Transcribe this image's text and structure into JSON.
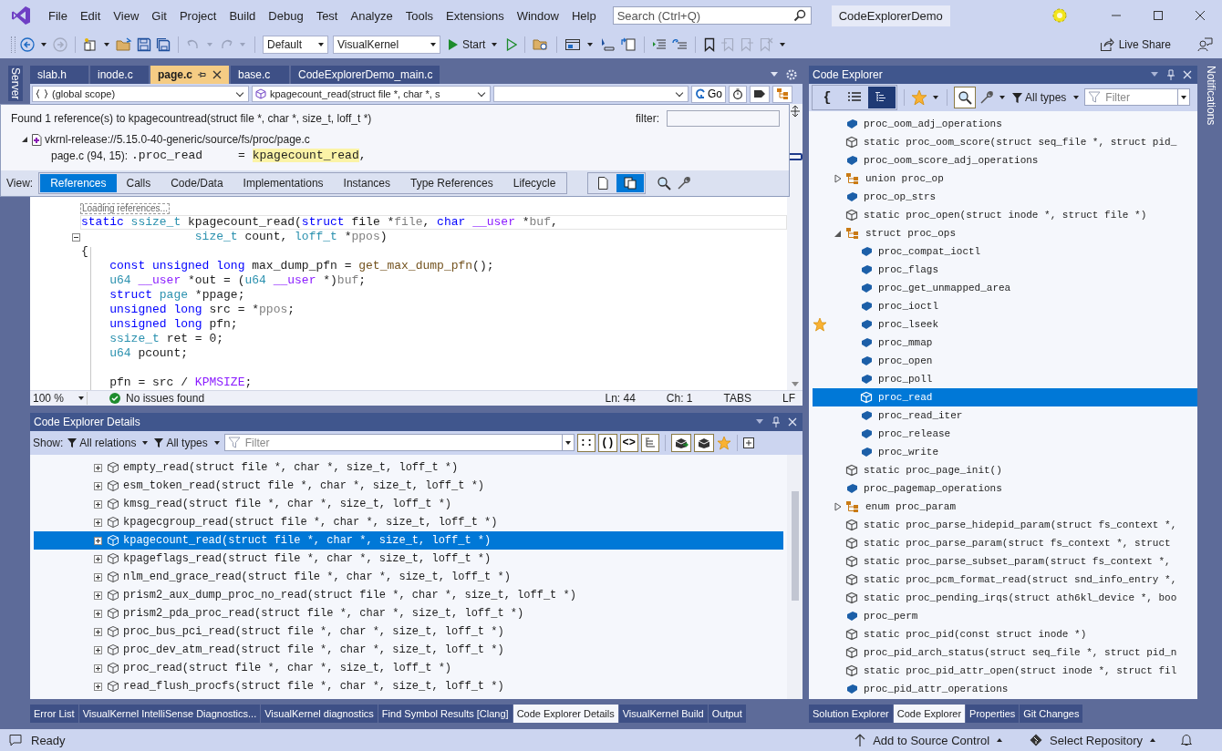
{
  "menu": [
    "File",
    "Edit",
    "View",
    "Git",
    "Project",
    "Build",
    "Debug",
    "Test",
    "Analyze",
    "Tools",
    "Extensions",
    "Window",
    "Help"
  ],
  "search": {
    "placeholder": "Search (Ctrl+Q)"
  },
  "solution_name": "CodeExplorerDemo",
  "toolbar": {
    "configuration": "Default",
    "platform": "VisualKernel",
    "start": "Start",
    "live_share": "Live Share"
  },
  "left_strip": "Server",
  "right_strip": "Notifications",
  "editor_tabs": [
    {
      "label": "slab.h",
      "selected": false
    },
    {
      "label": "inode.c",
      "selected": false
    },
    {
      "label": "page.c",
      "selected": true
    },
    {
      "label": "base.c",
      "selected": false
    },
    {
      "label": "CodeExplorerDemo_main.c",
      "selected": false
    }
  ],
  "nav_bar": {
    "scope": "(global scope)",
    "member": "kpagecount_read(struct file *, char *, s",
    "go": "Go"
  },
  "references_popup": {
    "summary": "Found 1 reference(s) to kpagecountread(struct file *, char *, size_t, loff_t *)",
    "filter_label": "filter:",
    "file": "vkrnl-release://5.15.0-40-generic/source/fs/proc/page.c",
    "expanded": true,
    "location": "page.c (94, 15):",
    "code_before": ".proc_read     = ",
    "match": "kpagecount_read",
    "code_after": ",",
    "view_label": "View:",
    "views": [
      {
        "label": "References",
        "selected": true
      },
      {
        "label": "Calls",
        "selected": false
      },
      {
        "label": "Code/Data",
        "selected": false
      },
      {
        "label": "Implementations",
        "selected": false
      },
      {
        "label": "Instances",
        "selected": false
      },
      {
        "label": "Type References",
        "selected": false
      },
      {
        "label": "Lifecycle",
        "selected": false
      }
    ]
  },
  "loading_hint": "Loading references...",
  "code_lines": [
    {
      "current": true,
      "tokens": [
        {
          "text": "static",
          "kind": "keyword"
        },
        {
          "text": " ssize_t",
          "kind": "type"
        },
        {
          "text": " kpagecount_read(",
          "kind": "plain"
        },
        {
          "text": "struct",
          "kind": "keyword"
        },
        {
          "text": " file *",
          "kind": "plain"
        },
        {
          "text": "file",
          "kind": "parameter"
        },
        {
          "text": ", ",
          "kind": "plain"
        },
        {
          "text": "char",
          "kind": "keyword"
        },
        {
          "text": " __user",
          "kind": "macro"
        },
        {
          "text": " *",
          "kind": "plain"
        },
        {
          "text": "buf",
          "kind": "parameter"
        },
        {
          "text": ",",
          "kind": "plain"
        }
      ]
    },
    {
      "current": false,
      "fold": true,
      "tokens": [
        {
          "text": "                size_t",
          "kind": "type"
        },
        {
          "text": " count, ",
          "kind": "plain"
        },
        {
          "text": "loff_t",
          "kind": "type"
        },
        {
          "text": " *",
          "kind": "plain"
        },
        {
          "text": "ppos",
          "kind": "parameter"
        },
        {
          "text": ")",
          "kind": "plain"
        }
      ]
    },
    {
      "current": false,
      "tokens": [
        {
          "text": "{",
          "kind": "plain"
        }
      ]
    },
    {
      "current": false,
      "tokens": [
        {
          "text": "    const unsigned long",
          "kind": "keyword"
        },
        {
          "text": " max_dump_pfn = ",
          "kind": "plain"
        },
        {
          "text": "get_max_dump_pfn",
          "kind": "function"
        },
        {
          "text": "();",
          "kind": "plain"
        }
      ]
    },
    {
      "current": false,
      "tokens": [
        {
          "text": "    u64",
          "kind": "type"
        },
        {
          "text": " __user",
          "kind": "macro"
        },
        {
          "text": " *out = (",
          "kind": "plain"
        },
        {
          "text": "u64",
          "kind": "type"
        },
        {
          "text": " __user",
          "kind": "macro"
        },
        {
          "text": " *)",
          "kind": "plain"
        },
        {
          "text": "buf",
          "kind": "parameter"
        },
        {
          "text": ";",
          "kind": "plain"
        }
      ]
    },
    {
      "current": false,
      "tokens": [
        {
          "text": "    struct",
          "kind": "keyword"
        },
        {
          "text": " page",
          "kind": "type"
        },
        {
          "text": " *ppage;",
          "kind": "plain"
        }
      ]
    },
    {
      "current": false,
      "tokens": [
        {
          "text": "    unsigned long",
          "kind": "keyword"
        },
        {
          "text": " src = *",
          "kind": "plain"
        },
        {
          "text": "ppos",
          "kind": "parameter"
        },
        {
          "text": ";",
          "kind": "plain"
        }
      ]
    },
    {
      "current": false,
      "tokens": [
        {
          "text": "    unsigned long",
          "kind": "keyword"
        },
        {
          "text": " pfn;",
          "kind": "plain"
        }
      ]
    },
    {
      "current": false,
      "tokens": [
        {
          "text": "    ssize_t",
          "kind": "type"
        },
        {
          "text": " ret = 0;",
          "kind": "plain"
        }
      ]
    },
    {
      "current": false,
      "tokens": [
        {
          "text": "    u64",
          "kind": "type"
        },
        {
          "text": " pcount;",
          "kind": "plain"
        }
      ]
    },
    {
      "current": false,
      "blank_before": true,
      "tokens": [
        {
          "text": "    pfn = src / ",
          "kind": "plain"
        },
        {
          "text": "KPMSIZE",
          "kind": "macro"
        },
        {
          "text": ";",
          "kind": "plain"
        }
      ]
    }
  ],
  "editor_status": {
    "zoom": "100 %",
    "issues": "No issues found",
    "line": "Ln: 44",
    "column": "Ch: 1",
    "indent": "TABS",
    "line_ending": "LF"
  },
  "details": {
    "title": "Code Explorer Details",
    "show_label": "Show:",
    "relations": "All relations",
    "types": "All types",
    "filter_placeholder": "Filter",
    "glyph_buttons": [
      "::",
      "()",
      "<>"
    ],
    "rows": [
      {
        "label": "empty_read(struct file *, char *, size_t, loff_t *)",
        "selected": false
      },
      {
        "label": "esm_token_read(struct file *, char *, size_t, loff_t *)",
        "selected": false
      },
      {
        "label": "kmsg_read(struct file *, char *, size_t, loff_t *)",
        "selected": false
      },
      {
        "label": "kpagecgroup_read(struct file *, char *, size_t, loff_t *)",
        "selected": false
      },
      {
        "label": "kpagecount_read(struct file *, char *, size_t, loff_t *)",
        "selected": true
      },
      {
        "label": "kpageflags_read(struct file *, char *, size_t, loff_t *)",
        "selected": false
      },
      {
        "label": "nlm_end_grace_read(struct file *, char *, size_t, loff_t *)",
        "selected": false
      },
      {
        "label": "prism2_aux_dump_proc_no_read(struct file *, char *, size_t, loff_t *)",
        "selected": false
      },
      {
        "label": "prism2_pda_proc_read(struct file *, char *, size_t, loff_t *)",
        "selected": false
      },
      {
        "label": "proc_bus_pci_read(struct file *, char *, size_t, loff_t *)",
        "selected": false
      },
      {
        "label": "proc_dev_atm_read(struct file *, char *, size_t, loff_t *)",
        "selected": false
      },
      {
        "label": "proc_read(struct file *, char *, size_t, loff_t *)",
        "selected": false
      },
      {
        "label": "read_flush_procfs(struct file *, char *, size_t, loff_t *)",
        "selected": false
      }
    ]
  },
  "code_explorer": {
    "title": "Code Explorer",
    "brace_button": "{",
    "types": "All types",
    "filter_placeholder": "Filter",
    "items": [
      {
        "kind": "field",
        "label": "proc_oom_adj_operations",
        "selected": false,
        "starred": false
      },
      {
        "kind": "method",
        "label": "static proc_oom_score(struct seq_file *, struct pid_",
        "selected": false,
        "starred": false
      },
      {
        "kind": "field",
        "label": "proc_oom_score_adj_operations",
        "selected": false,
        "starred": false
      },
      {
        "kind": "struct",
        "label": "union proc_op",
        "selected": false,
        "starred": false,
        "expanded": false
      },
      {
        "kind": "field",
        "label": "proc_op_strs",
        "selected": false,
        "starred": false
      },
      {
        "kind": "method",
        "label": "static proc_open(struct inode *, struct file *)",
        "selected": false,
        "starred": false
      },
      {
        "kind": "struct",
        "label": "struct proc_ops",
        "selected": false,
        "starred": false,
        "expanded": true,
        "children": [
          {
            "kind": "field",
            "label": "proc_compat_ioctl",
            "selected": false,
            "starred": false
          },
          {
            "kind": "field",
            "label": "proc_flags",
            "selected": false,
            "starred": false
          },
          {
            "kind": "field",
            "label": "proc_get_unmapped_area",
            "selected": false,
            "starred": false
          },
          {
            "kind": "field",
            "label": "proc_ioctl",
            "selected": false,
            "starred": false
          },
          {
            "kind": "field",
            "label": "proc_lseek",
            "selected": false,
            "starred": true
          },
          {
            "kind": "field",
            "label": "proc_mmap",
            "selected": false,
            "starred": false
          },
          {
            "kind": "field",
            "label": "proc_open",
            "selected": false,
            "starred": false
          },
          {
            "kind": "field",
            "label": "proc_poll",
            "selected": false,
            "starred": false
          },
          {
            "kind": "method",
            "label": "proc_read",
            "selected": true,
            "starred": false
          },
          {
            "kind": "field",
            "label": "proc_read_iter",
            "selected": false,
            "starred": false
          },
          {
            "kind": "field",
            "label": "proc_release",
            "selected": false,
            "starred": false
          },
          {
            "kind": "field",
            "label": "proc_write",
            "selected": false,
            "starred": false
          }
        ]
      },
      {
        "kind": "method",
        "label": "static proc_page_init()",
        "selected": false,
        "starred": false
      },
      {
        "kind": "field",
        "label": "proc_pagemap_operations",
        "selected": false,
        "starred": false
      },
      {
        "kind": "struct",
        "label": "enum proc_param",
        "selected": false,
        "starred": false,
        "expanded": false
      },
      {
        "kind": "method",
        "label": "static proc_parse_hidepid_param(struct fs_context *,",
        "selected": false,
        "starred": false
      },
      {
        "kind": "method",
        "label": "static proc_parse_param(struct fs_context *, struct",
        "selected": false,
        "starred": false
      },
      {
        "kind": "method",
        "label": "static proc_parse_subset_param(struct fs_context *,",
        "selected": false,
        "starred": false
      },
      {
        "kind": "method",
        "label": "static proc_pcm_format_read(struct snd_info_entry *,",
        "selected": false,
        "starred": false
      },
      {
        "kind": "method",
        "label": "static proc_pending_irqs(struct ath6kl_device *, boo",
        "selected": false,
        "starred": false
      },
      {
        "kind": "field",
        "label": "proc_perm",
        "selected": false,
        "starred": false
      },
      {
        "kind": "method",
        "label": "static proc_pid(const struct inode *)",
        "selected": false,
        "starred": false
      },
      {
        "kind": "method",
        "label": "proc_pid_arch_status(struct seq_file *, struct pid_n",
        "selected": false,
        "starred": false
      },
      {
        "kind": "method",
        "label": "static proc_pid_attr_open(struct inode *, struct fil",
        "selected": false,
        "starred": false
      },
      {
        "kind": "field",
        "label": "proc_pid_attr_operations",
        "selected": false,
        "starred": false
      }
    ]
  },
  "bottom_tabs_left": [
    {
      "label": "Error List",
      "selected": false
    },
    {
      "label": "VisualKernel IntelliSense Diagnostics...",
      "selected": false
    },
    {
      "label": "VisualKernel diagnostics",
      "selected": false
    },
    {
      "label": "Find Symbol Results [Clang]",
      "selected": false
    },
    {
      "label": "Code Explorer Details",
      "selected": true
    },
    {
      "label": "VisualKernel Build",
      "selected": false
    },
    {
      "label": "Output",
      "selected": false
    }
  ],
  "bottom_tabs_right": [
    {
      "label": "Solution Explorer",
      "selected": false
    },
    {
      "label": "Code Explorer",
      "selected": true
    },
    {
      "label": "Properties",
      "selected": false
    },
    {
      "label": "Git Changes",
      "selected": false
    }
  ],
  "status_bar": {
    "state": "Ready",
    "source_control": "Add to Source Control",
    "repository": "Select Repository"
  }
}
